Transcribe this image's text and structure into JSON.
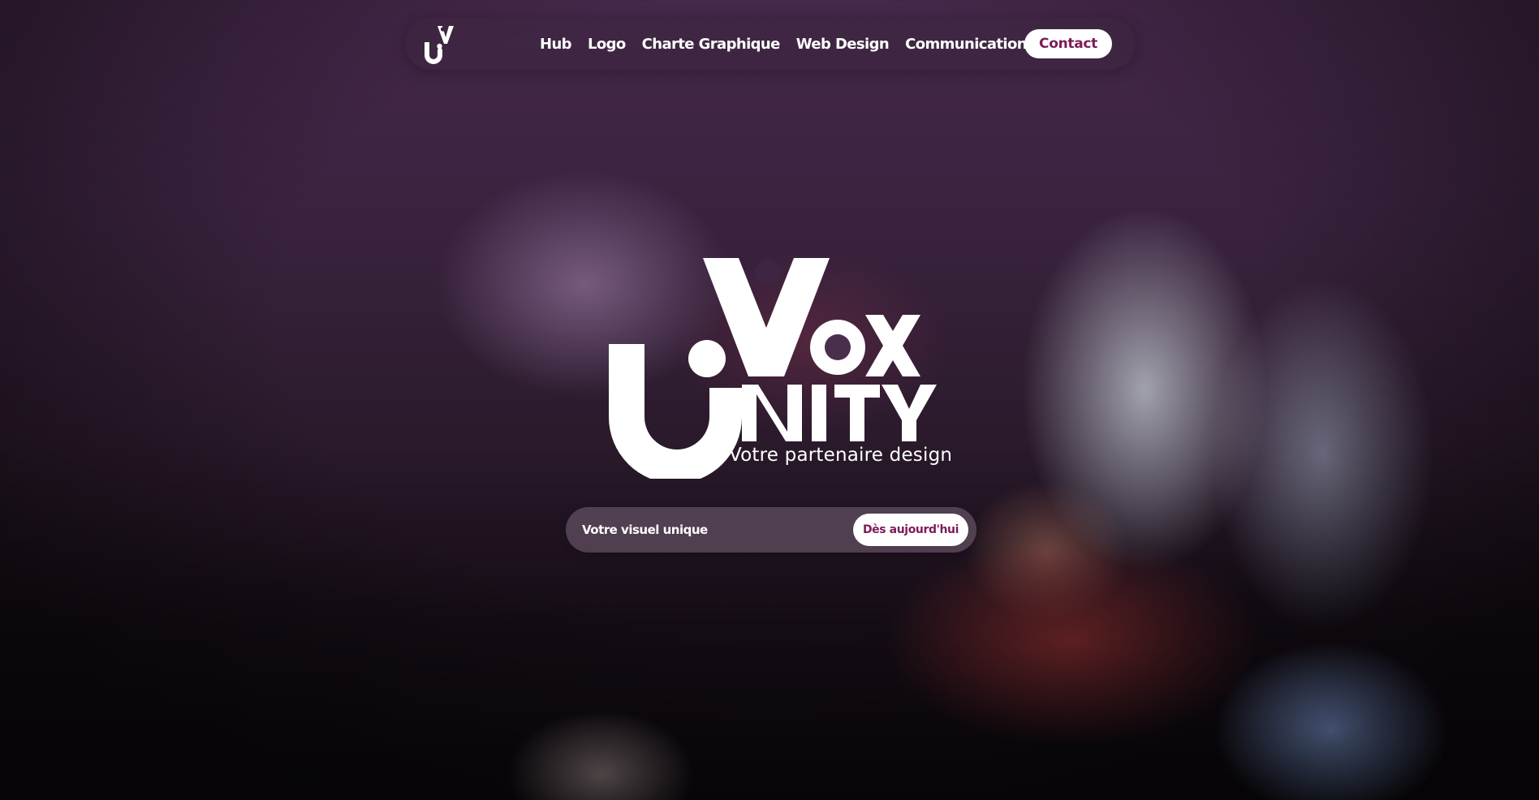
{
  "nav": {
    "logo_icon": "vox-unity-mini-logo-icon",
    "links": [
      {
        "label": "Hub"
      },
      {
        "label": "Logo"
      },
      {
        "label": "Charte Graphique"
      },
      {
        "label": "Web Design"
      },
      {
        "label": "Communication"
      }
    ],
    "contact_label": "Contact"
  },
  "hero": {
    "logo_text": "VOX UNITY",
    "logo_icon": "vox-unity-logo",
    "tagline": "Votre partenaire design"
  },
  "cta": {
    "label": "Votre visuel unique",
    "button_label": "Dès aujourd'hui"
  },
  "colors": {
    "accent": "#7d1b56",
    "text": "#ffffff",
    "background_top": "#45284a",
    "background_bottom": "#0a070b"
  }
}
